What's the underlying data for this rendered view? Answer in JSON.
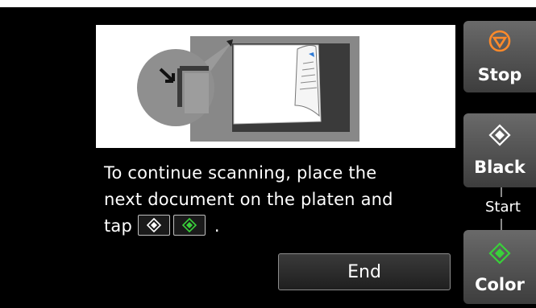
{
  "message": {
    "line1": "To continue scanning, place the",
    "line2": "next document on the platen and",
    "line3_prefix": "tap",
    "line3_suffix": "."
  },
  "end_button": {
    "label": "End"
  },
  "side_buttons": {
    "stop": {
      "label": "Stop",
      "icon": "stop-icon",
      "color": "#ff8a2a"
    },
    "black": {
      "label": "Black",
      "icon": "start-diamond-icon",
      "color": "#ffffff"
    },
    "start_label": "Start",
    "color": {
      "label": "Color",
      "icon": "start-diamond-icon",
      "color": "#39d13a"
    }
  },
  "illustration": {
    "icon": "place-document-on-platen-illustration"
  },
  "colors": {
    "background": "#000000",
    "stop_accent": "#ff8a2a",
    "color_accent": "#39d13a",
    "button_gray": "#5a5a5a"
  }
}
